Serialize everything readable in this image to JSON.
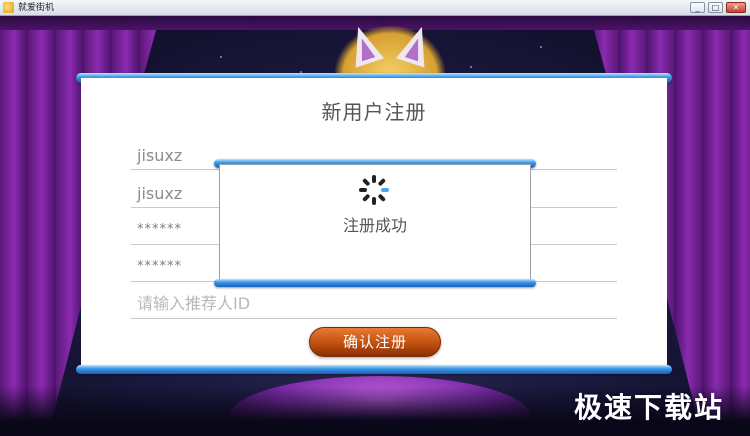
{
  "window": {
    "title": "就爱街机",
    "minimize_glyph": "_",
    "maximize_glyph": "□",
    "close_glyph": "✕"
  },
  "register": {
    "title": "新用户注册",
    "fields": [
      {
        "value": "jisuxz"
      },
      {
        "value": "jisuxz"
      },
      {
        "value": "******"
      },
      {
        "value": "******"
      },
      {
        "placeholder": "请输入推荐人ID"
      }
    ],
    "confirm_label": "确认注册"
  },
  "dialog": {
    "message": "注册成功"
  },
  "watermark": "极速下载站",
  "colors": {
    "accent_blue": "#3a98e8",
    "button_orange": "#c0500e"
  }
}
